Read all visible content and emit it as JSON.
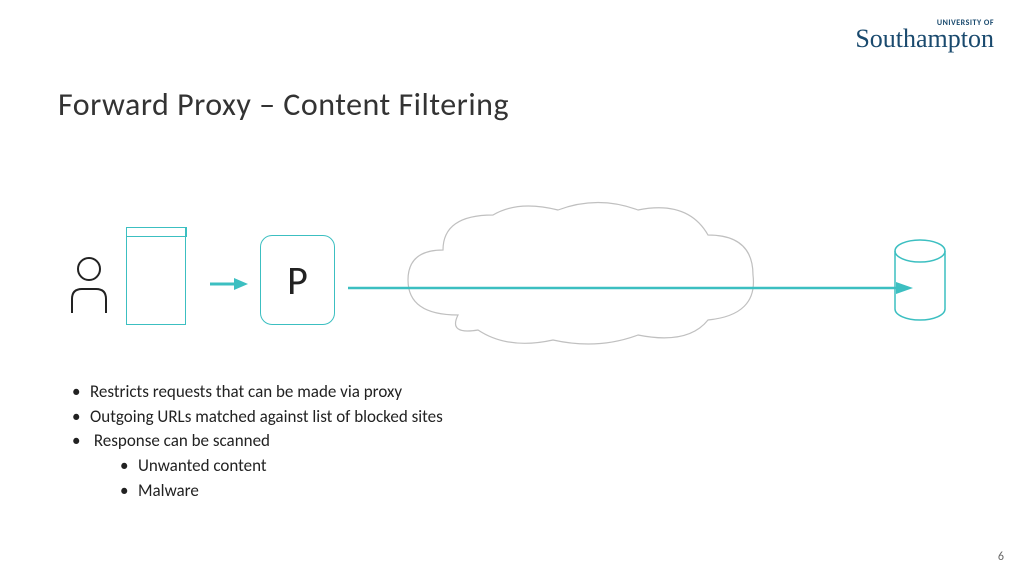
{
  "logo": {
    "sub": "UNIVERSITY OF",
    "main": "Southampton"
  },
  "title": "Forward Proxy – Content Filtering",
  "diagram": {
    "proxy_label": "P",
    "accent_color": "#3cbfc1",
    "outline_color": "#b8b8b8"
  },
  "bullets": [
    "Restricts requests that can be made via proxy",
    "Outgoing URLs matched against list of blocked sites",
    "Response can be scanned"
  ],
  "sub_bullets": [
    "Unwanted content",
    "Malware"
  ],
  "page_number": "6"
}
